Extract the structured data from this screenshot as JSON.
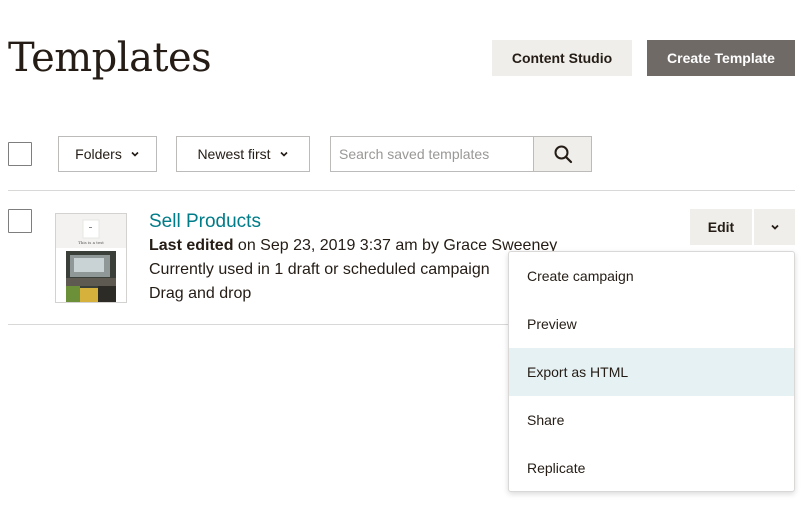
{
  "header": {
    "title": "Templates",
    "content_studio_label": "Content Studio",
    "create_template_label": "Create Template"
  },
  "toolbar": {
    "folders_label": "Folders",
    "sort_label": "Newest first",
    "search_placeholder": "Search saved templates"
  },
  "templates": [
    {
      "title": "Sell Products",
      "last_edited_label": "Last edited",
      "last_edited_rest": " on Sep 23, 2019 3:37 am by Grace Sweeney",
      "usage": "Currently used in 1 draft or scheduled campaign",
      "type": "Drag and drop",
      "thumb_text": "This is a test",
      "edit_label": "Edit"
    }
  ],
  "menu": {
    "items": [
      {
        "label": "Create campaign"
      },
      {
        "label": "Preview"
      },
      {
        "label": "Export as HTML"
      },
      {
        "label": "Share"
      },
      {
        "label": "Replicate"
      }
    ],
    "highlighted": "Export as HTML"
  },
  "colors": {
    "link": "#007c89",
    "primary_button": "#6f6a66",
    "secondary_button": "#efeeea",
    "menu_highlight": "#e6f1f3"
  },
  "icons": [
    "search-icon",
    "chevron-down-icon"
  ]
}
